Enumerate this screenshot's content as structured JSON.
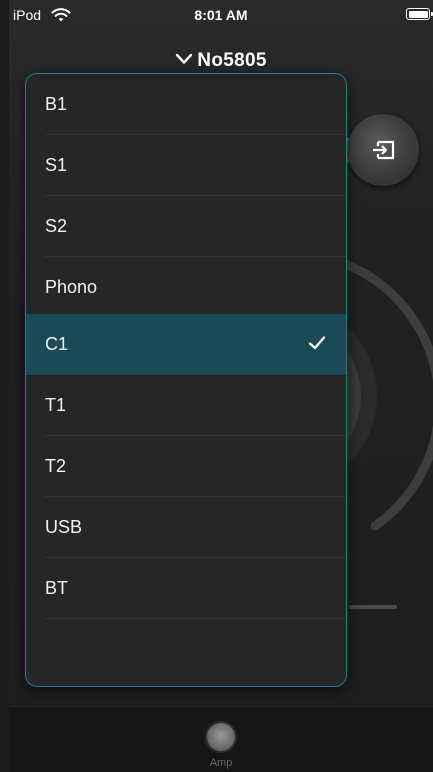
{
  "status_bar": {
    "carrier": "iPod",
    "time": "8:01 AM"
  },
  "header": {
    "device_name": "No5805"
  },
  "source_menu": {
    "selected": "C1",
    "options": [
      {
        "label": "B1"
      },
      {
        "label": "S1"
      },
      {
        "label": "S2"
      },
      {
        "label": "Phono"
      },
      {
        "label": "C1"
      },
      {
        "label": "T1"
      },
      {
        "label": "T2"
      },
      {
        "label": "USB"
      },
      {
        "label": "BT"
      }
    ]
  },
  "tab_bar": {
    "amp_label": "Amp"
  },
  "colors": {
    "accent": "#1d9fb2",
    "selected_row": "#1a4a55",
    "background": "#1e1e1e"
  },
  "icons": {
    "wifi": "wifi-icon",
    "battery": "battery-icon",
    "chevron": "chevron-down-icon",
    "input": "input-switch-icon",
    "check": "checkmark-icon"
  }
}
